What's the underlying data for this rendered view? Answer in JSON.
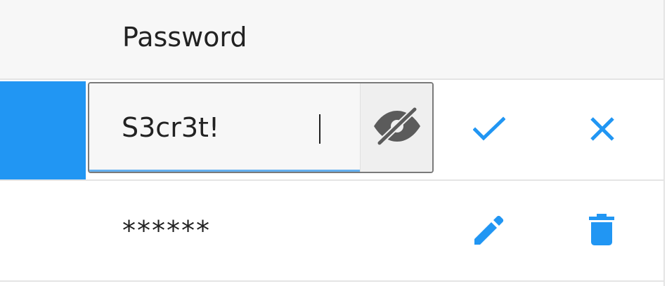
{
  "header": {
    "password_label": "Password"
  },
  "edit_row": {
    "password_value": "S3cr3t!",
    "visibility_icon": "eye-slash-icon",
    "save_icon": "check-icon",
    "cancel_icon": "close-icon"
  },
  "view_row": {
    "masked_password": "******",
    "edit_icon": "pencil-icon",
    "delete_icon": "trash-icon"
  },
  "colors": {
    "accent": "#2196f3",
    "icon_gray": "#555555",
    "focus_underline": "#64b0ef",
    "border": "#e4e4e4"
  }
}
